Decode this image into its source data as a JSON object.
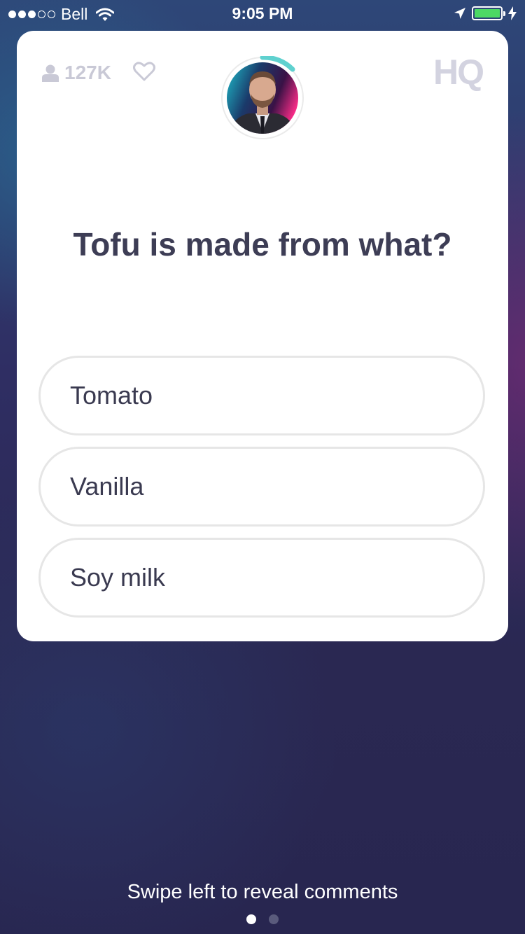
{
  "status_bar": {
    "carrier": "Bell",
    "time": "9:05 PM",
    "signal_full": 3,
    "signal_total": 5,
    "battery_level": 1.0,
    "battery_color": "#4cd964"
  },
  "card": {
    "viewer_count": "127K",
    "logo": "HQ",
    "question": "Tofu is made from what?",
    "answers": [
      {
        "label": "Tomato"
      },
      {
        "label": "Vanilla"
      },
      {
        "label": "Soy milk"
      }
    ],
    "timer_color": "#5fd1cf"
  },
  "footer": {
    "hint": "Swipe left to reveal comments",
    "pages": 2,
    "active_page": 1
  },
  "icons": [
    "wifi-icon",
    "location-arrow-icon",
    "charging-bolt-icon",
    "person-icon",
    "heart-icon"
  ]
}
